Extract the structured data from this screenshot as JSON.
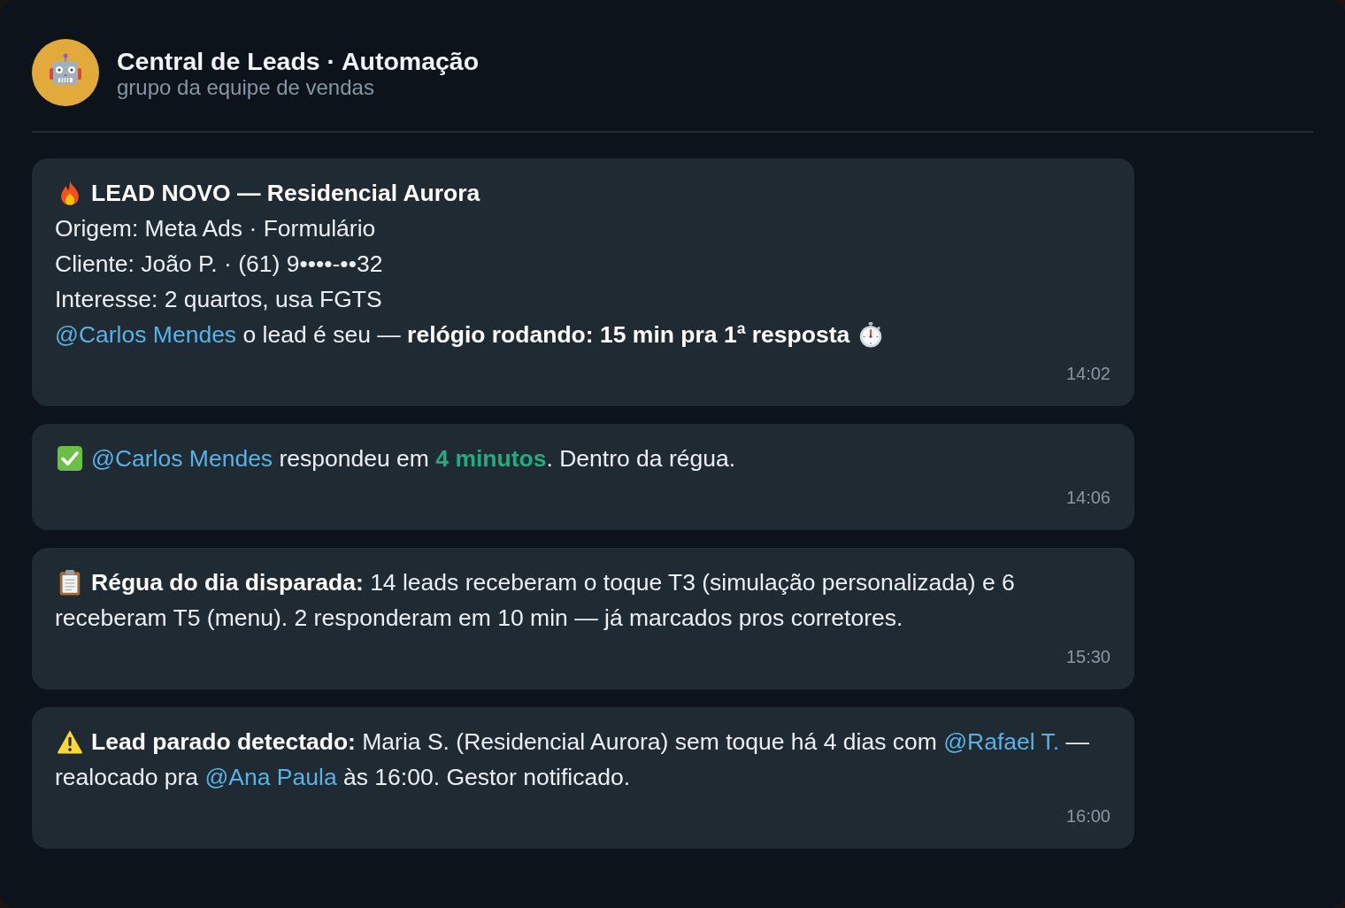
{
  "chat": {
    "title": "Central de Leads · Automação",
    "subtitle": "grupo da equipe de vendas"
  },
  "messages": [
    {
      "kind": "new_lead",
      "title": "LEAD NOVO — Residencial Aurora",
      "lines": [
        "Origem: Meta Ads · Formulário",
        "Cliente: João P. · (61) 9••••-••32",
        "Interesse: 2 quartos, usa FGTS"
      ],
      "segments": [
        {
          "kind": "mention",
          "text": "@Carlos Mendes"
        },
        {
          "kind": "text",
          "text": " o lead é seu — **relógio rodando: 15 min pra 1ª resposta**"
        }
      ],
      "time": "14:02"
    },
    {
      "kind": "response_ok",
      "segments": [
        {
          "kind": "mention",
          "text": "@Carlos Mendes"
        },
        {
          "kind": "text",
          "text": " respondeu em "
        },
        {
          "kind": "highlight",
          "text": "4 minutos"
        },
        {
          "kind": "text",
          "text": ". Dentro da régua."
        }
      ],
      "time": "14:06"
    },
    {
      "kind": "cadence",
      "segments": [
        {
          "kind": "text",
          "text": "**Régua do dia disparada:** 14 leads receberam o toque T3 (simulação personalizada) e 6 receberam T5 (menu). 2 responderam em 10 min — já marcados pros corretores."
        }
      ],
      "time": "15:30"
    },
    {
      "kind": "stalled_lead",
      "segments": [
        {
          "kind": "text",
          "text": "**Lead parado detectado:** Maria S. (Residencial Aurora) sem toque há 4 dias com "
        },
        {
          "kind": "mention",
          "text": "@Rafael T."
        },
        {
          "kind": "text",
          "text": " — realocado pra "
        },
        {
          "kind": "mention",
          "text": "@Ana Paula"
        },
        {
          "kind": "text",
          "text": " às 16:00. Gestor notificado."
        }
      ],
      "time": "16:00"
    }
  ]
}
